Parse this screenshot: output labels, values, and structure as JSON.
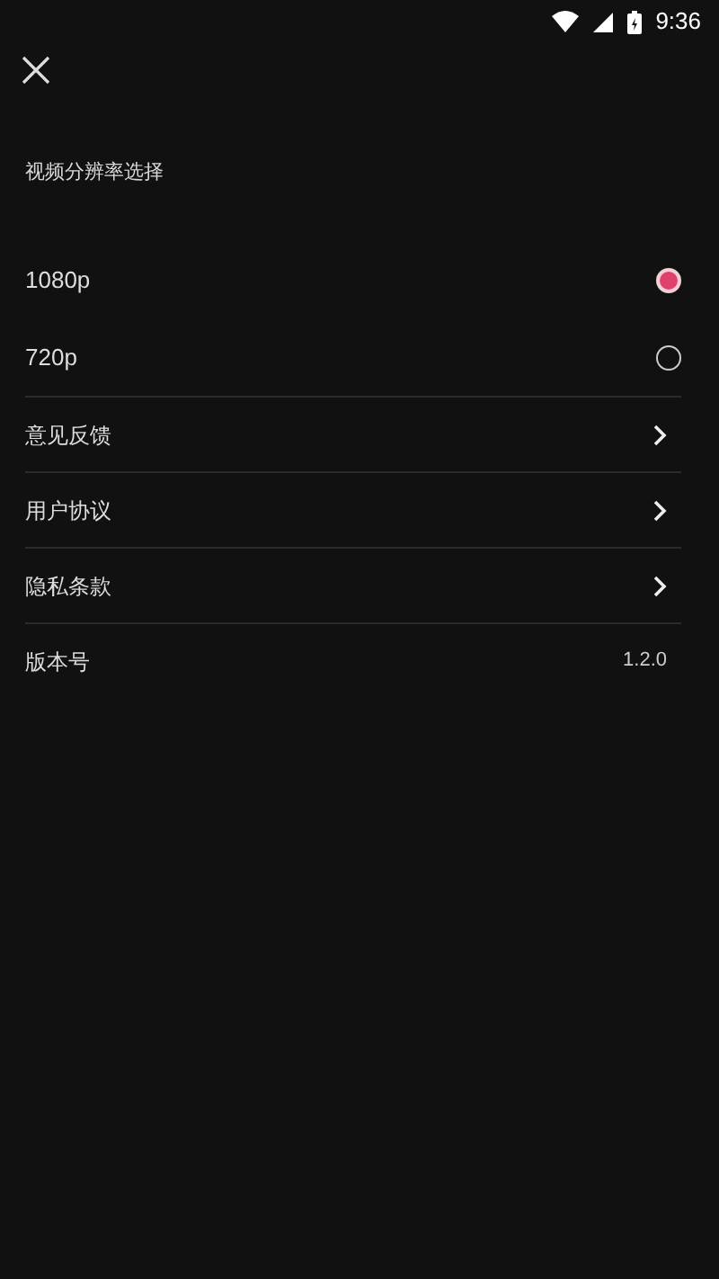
{
  "status_bar": {
    "time": "9:36"
  },
  "section_title": "视频分辨率选择",
  "resolutions": [
    {
      "label": "1080p",
      "selected": true
    },
    {
      "label": "720p",
      "selected": false
    }
  ],
  "menu_items": [
    {
      "label": "意见反馈",
      "kind": "link"
    },
    {
      "label": "用户协议",
      "kind": "link"
    },
    {
      "label": "隐私条款",
      "kind": "link"
    },
    {
      "label": "版本号",
      "kind": "value",
      "value": "1.2.0"
    }
  ]
}
